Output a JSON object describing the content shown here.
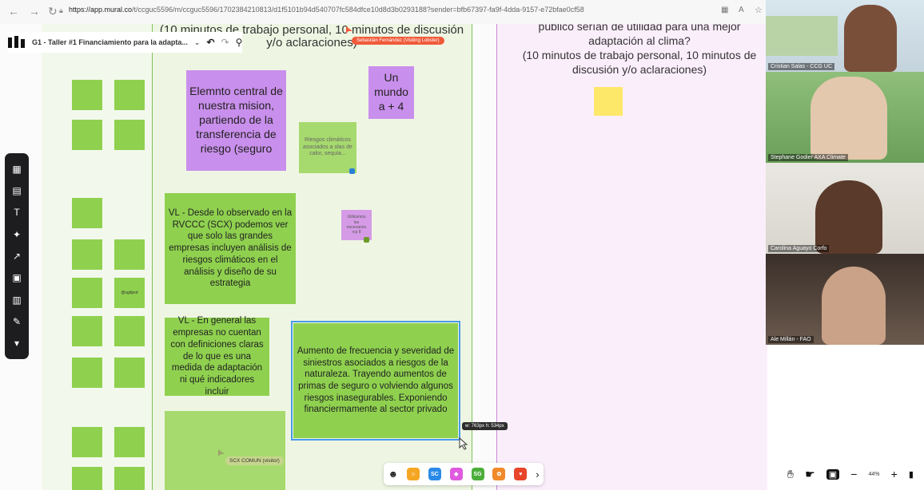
{
  "browser": {
    "url_host": "https://app.mural.co",
    "url_path": "/t/ccguc5596/m/ccguc5596/1702384210813/d1f5101b94d540707fc584dfce10d8d3b0293188?sender=bfb67397-fa9f-4dda-9157-e72bfae0cf58"
  },
  "mural": {
    "board_title": "G1 - Taller #1 Financiamiento para la adapta..."
  },
  "canvas": {
    "header_left": "(10 minutos de trabajo personal, 10 minutos de discusión y/o aclaraciones)",
    "header_right_line1": "público serían de utilidad para una mejor",
    "header_right_line2": "adaptación al clima?",
    "header_right_line3": "(10 minutos de trabajo personal, 10 minutos de",
    "header_right_line4": "discusión y/o aclaraciones)",
    "cursor_sebastian": "Sebastián Fernández (Visiting Lobster)",
    "cursor_scx": "SCX COMUN (visitor)",
    "small_label": "@sgdpxd",
    "dimension_tag": "w: 763px h: 534px",
    "notes": {
      "n1": "Elemnto central de nuestra mision, partiendo de la transferencia de riesgo (seguro",
      "n2": "Un mundo a + 4",
      "n3": "Riesgos climáticos asociados a olas de calor, sequía...",
      "n4": "Utilizamos las escenarios rcp 8",
      "n5": "VL - Desde lo observado en la RVCCC (SCX) podemos ver que solo las grandes empresas incluyen análisis de riesgos climáticos en el análisis y diseño de su estrategia",
      "n6": "VL - En general las empresas no cuentan con definiciones claras de lo que es una medida de adaptación ni qué indicadores incluir",
      "n7": "Aumento de frecuencia y severidad de siniestros asociados a riesgos de la naturaleza. Trayendo aumentos de primas de seguro o volviendo algunos riesgos inasegurables. Exponiendo financiermamente al sector privado"
    }
  },
  "bottom_toolbar": {
    "items": [
      "☻",
      "SC",
      "SG",
      "›"
    ]
  },
  "zoom": {
    "level": "44%",
    "minus": "−",
    "plus": "+"
  },
  "participants": [
    {
      "name": "Cristian Salas - CCG UC"
    },
    {
      "name": "Stephane Godier AXA Climate"
    },
    {
      "name": "Carolina Aguayo Corfo"
    },
    {
      "name": "Ale Millán - FAO"
    }
  ],
  "colors": {
    "green_note": "#8fd14f",
    "light_green_note": "#a7da6e",
    "purple_note": "#c98fec",
    "yellow_note": "#fde86a",
    "pink_note": "#d59be6"
  }
}
